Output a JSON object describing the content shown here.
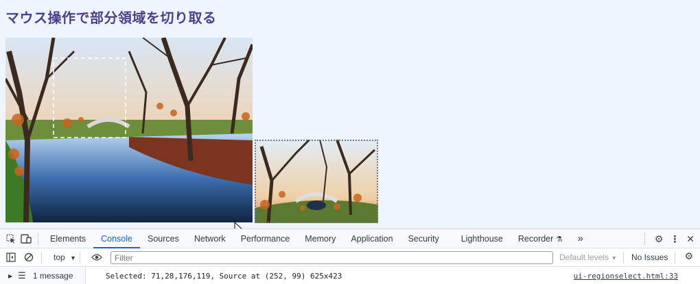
{
  "page": {
    "title": "マウス操作で部分領域を切り取る"
  },
  "devtools": {
    "tabs": [
      {
        "label": "Elements"
      },
      {
        "label": "Console"
      },
      {
        "label": "Sources"
      },
      {
        "label": "Network"
      },
      {
        "label": "Performance"
      },
      {
        "label": "Memory"
      },
      {
        "label": "Application"
      },
      {
        "label": "Security"
      },
      {
        "label": "Lighthouse"
      },
      {
        "label": "Recorder"
      }
    ],
    "active_tab": "Console",
    "more_tabs_icon": "»",
    "toolbar": {
      "context": "top",
      "filter_placeholder": "Filter",
      "levels": "Default levels",
      "issues": "No Issues"
    },
    "console": {
      "message_count": "1 message",
      "message": "Selected: 71,28,176,119, Source at (252, 99) 625x423",
      "source_link": "ui-regionselect.html:33"
    }
  }
}
